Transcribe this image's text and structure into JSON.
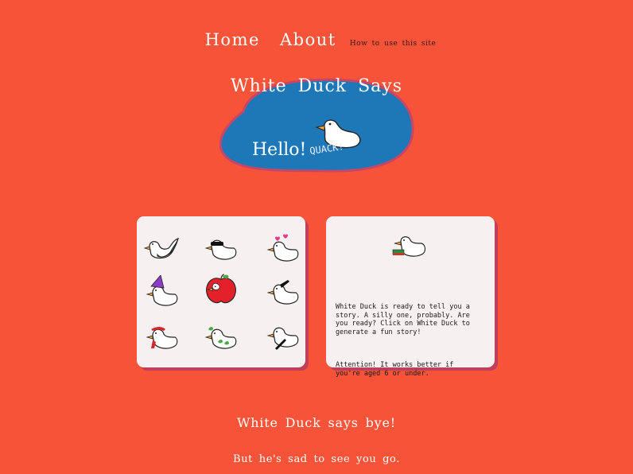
{
  "nav": {
    "home": "Home",
    "about": "About",
    "howto": "How to use this site"
  },
  "hero": {
    "title": "White Duck Says",
    "hello": "Hello!",
    "quack": "QUACK!",
    "blob_color": "#1e78b8"
  },
  "stickers": {
    "items": [
      {
        "name": "mermaid-duck-icon"
      },
      {
        "name": "sunglasses-duck-icon"
      },
      {
        "name": "love-hearts-duck-icon"
      },
      {
        "name": "wizard-hat-duck-icon"
      },
      {
        "name": "apple-duck-icon"
      },
      {
        "name": "knife-duck-icon"
      },
      {
        "name": "scarf-duck-icon"
      },
      {
        "name": "leaves-duck-icon"
      },
      {
        "name": "quill-duck-icon"
      }
    ]
  },
  "story_card": {
    "intro": "White Duck is ready to tell you a story. A silly one, probably. Are you ready? Click on White Duck to generate a fun story!",
    "attention": "Attention! It works better if you're aged 6 or under."
  },
  "footer": {
    "bye": "White Duck says bye!",
    "sad": "But he's sad to see you go."
  },
  "colors": {
    "background": "#f65339",
    "card": "#f6f0f0",
    "card_shadow": "#c0405a"
  }
}
